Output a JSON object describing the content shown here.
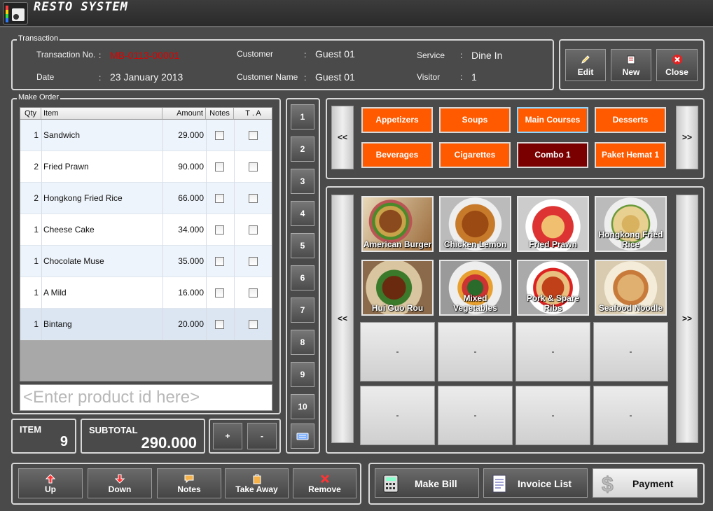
{
  "app": {
    "title": "RESTO SYSTEM"
  },
  "transaction": {
    "legend": "Transaction",
    "no_label": "Transaction No.",
    "no_value": "MB-0113-00001",
    "date_label": "Date",
    "date_value": "23 January 2013",
    "customer_label": "Customer",
    "customer_value": "Guest 01",
    "customer_name_label": "Customer Name",
    "customer_name_value": "Guest 01",
    "service_label": "Service",
    "service_value": "Dine In",
    "visitor_label": "Visitor",
    "visitor_value": "1",
    "separator": ":"
  },
  "actions": {
    "edit": "Edit",
    "new": "New",
    "close": "Close"
  },
  "order": {
    "legend": "Make Order",
    "columns": {
      "qty": "Qty",
      "item": "Item",
      "amount": "Amount",
      "notes": "Notes",
      "ta": "T . A"
    },
    "rows": [
      {
        "qty": "1",
        "item": "Sandwich",
        "amount": "29.000"
      },
      {
        "qty": "2",
        "item": "Fried Prawn",
        "amount": "90.000"
      },
      {
        "qty": "2",
        "item": "Hongkong Fried Rice",
        "amount": "66.000"
      },
      {
        "qty": "1",
        "item": "Cheese Cake",
        "amount": "34.000"
      },
      {
        "qty": "1",
        "item": "Chocolate Muse",
        "amount": "35.000"
      },
      {
        "qty": "1",
        "item": "A Mild",
        "amount": "16.000"
      },
      {
        "qty": "1",
        "item": "Bintang",
        "amount": "20.000"
      }
    ],
    "input_placeholder": "<Enter product id here>"
  },
  "totals": {
    "item_label": "ITEM",
    "item_value": "9",
    "subtotal_label": "SUBTOTAL",
    "subtotal_value": "290.000",
    "plus": "+",
    "minus": "-"
  },
  "numbers": [
    "1",
    "2",
    "3",
    "4",
    "5",
    "6",
    "7",
    "8",
    "9",
    "10"
  ],
  "categories": {
    "prev": "<<",
    "next": ">>",
    "items": [
      "Appetizers",
      "Soups",
      "Main Courses",
      "Desserts",
      "Beverages",
      "Cigarettes",
      "Combo 1",
      "Paket Hemat 1"
    ],
    "selected": "Combo 1",
    "highlighted": "Main Courses"
  },
  "products": {
    "prev": "<<",
    "next": ">>",
    "items": [
      {
        "name": "American Burger",
        "icon": "burger-photo"
      },
      {
        "name": "Chicken Lemon",
        "icon": "chicken-photo"
      },
      {
        "name": "Fried Prawn",
        "icon": "prawn-photo"
      },
      {
        "name": "Hongkong Fried Rice",
        "icon": "fried-rice-photo"
      },
      {
        "name": "Hui Guo Rou",
        "icon": "pork-dish-photo"
      },
      {
        "name": "Mixed Vegetables",
        "icon": "vegetables-photo"
      },
      {
        "name": "Pork & Spare Ribs",
        "icon": "ribs-photo"
      },
      {
        "name": "Seafood Noodle",
        "icon": "noodle-photo"
      }
    ],
    "empty_label": "-"
  },
  "bottom": {
    "up": "Up",
    "down": "Down",
    "notes": "Notes",
    "take_away": "Take Away",
    "remove": "Remove",
    "make_bill": "Make Bill",
    "invoice_list": "Invoice List",
    "payment": "Payment"
  }
}
